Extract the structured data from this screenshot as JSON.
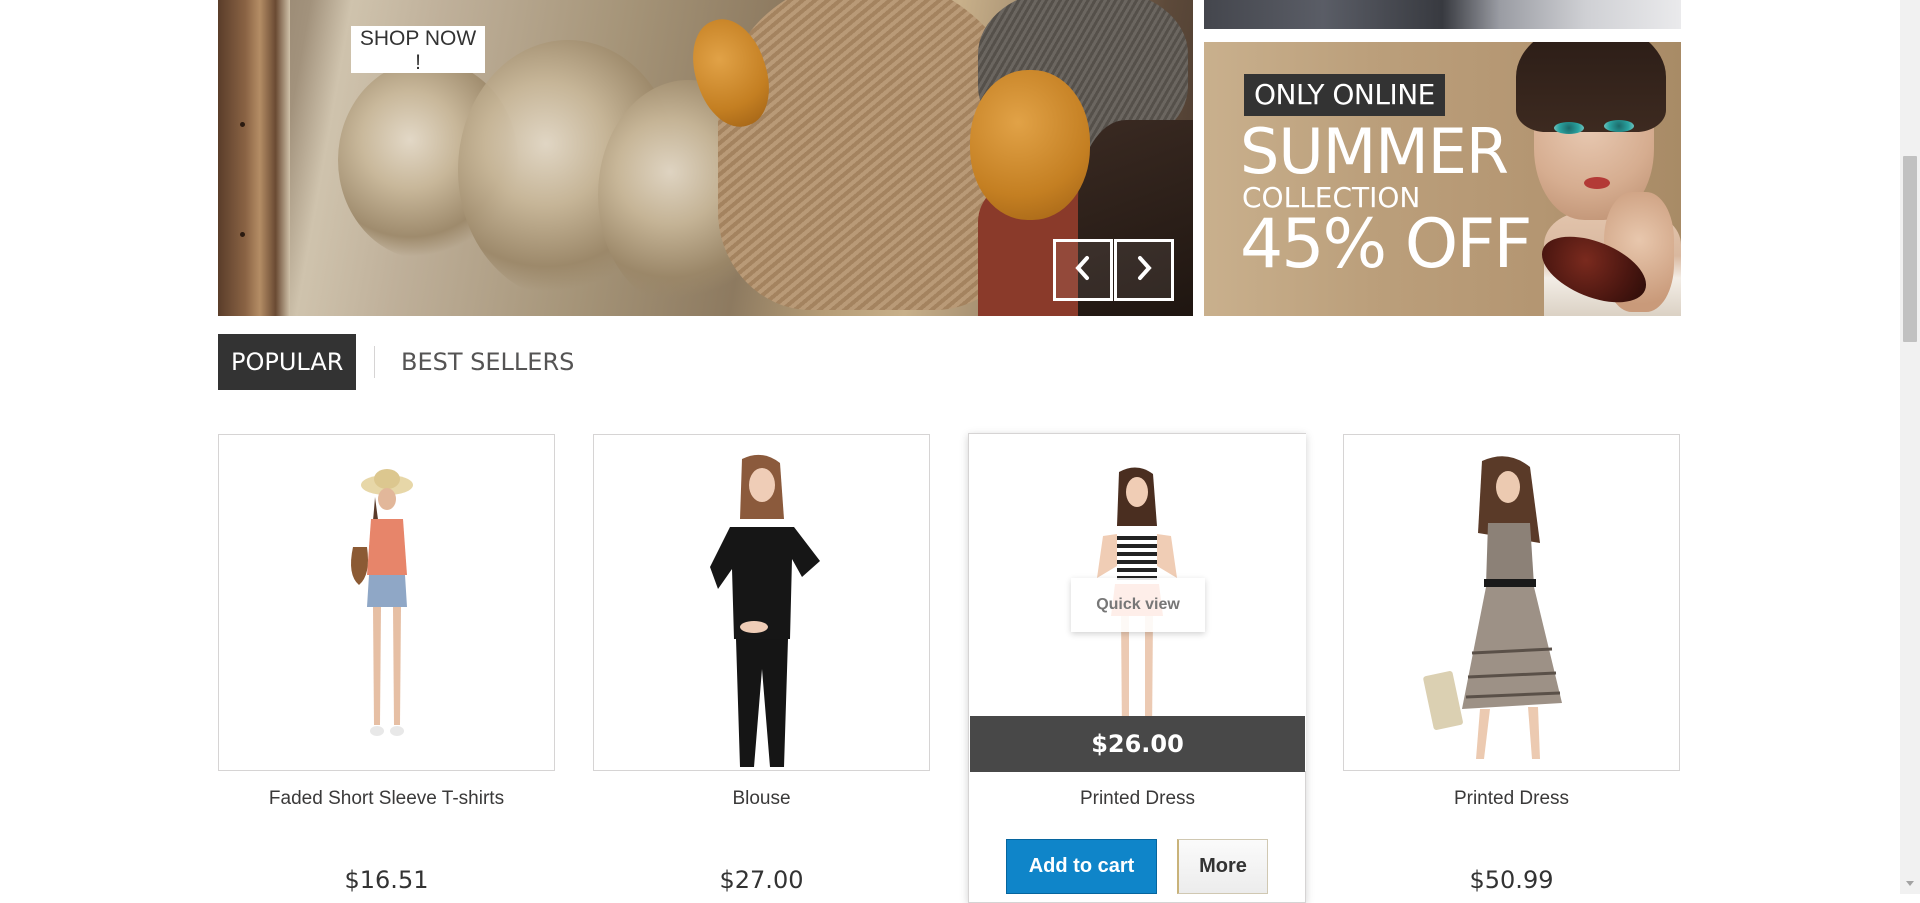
{
  "slider": {
    "shop_now_label": "SHOP NOW !",
    "prev_icon": "chevron-left-icon",
    "next_icon": "chevron-right-icon"
  },
  "banner": {
    "tag": "ONLY ONLINE",
    "headline": "SUMMER",
    "subline": "COLLECTION",
    "discount": "45% OFF"
  },
  "tabs": [
    {
      "label": "POPULAR",
      "active": true
    },
    {
      "label": "BEST SELLERS",
      "active": false
    }
  ],
  "products": [
    {
      "name": "Faded Short Sleeve T-shirts",
      "price": "$16.51"
    },
    {
      "name": "Blouse",
      "price": "$27.00"
    },
    {
      "name": "Printed Dress",
      "price": "$26.00"
    },
    {
      "name": "Printed Dress",
      "price": "$50.99"
    }
  ],
  "hover_card": {
    "quick_view_label": "Quick view",
    "add_to_cart_label": "Add to cart",
    "more_label": "More"
  },
  "colors": {
    "tab_active_bg": "#333333",
    "cart_button": "#0f85c9",
    "price_bar": "#484848"
  }
}
